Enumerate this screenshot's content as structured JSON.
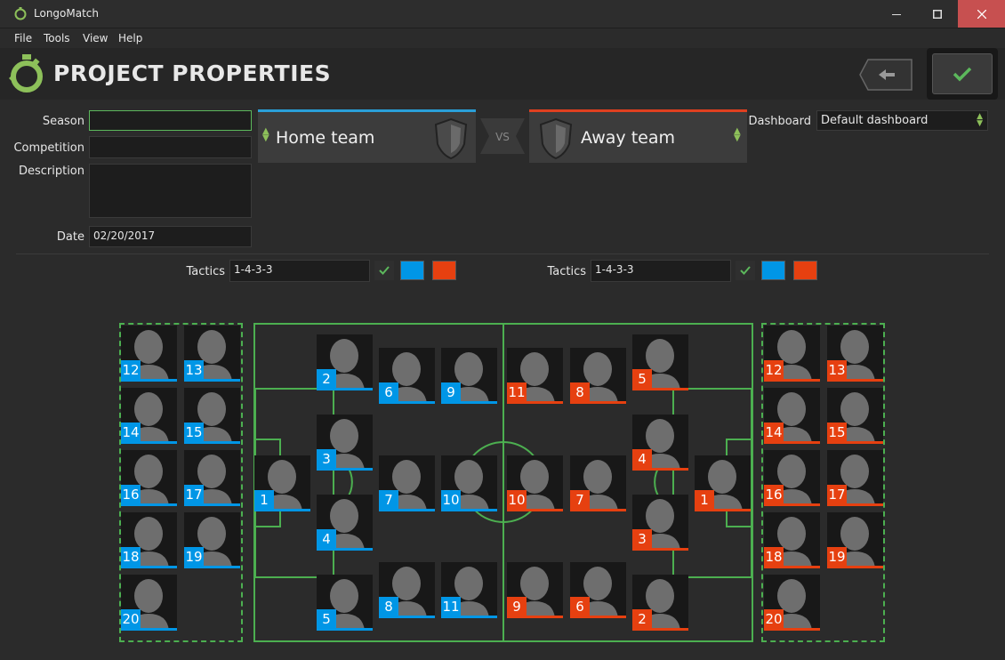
{
  "window": {
    "title": "LongoMatch"
  },
  "menu": [
    {
      "label": "File",
      "key": "F"
    },
    {
      "label": "Tools",
      "key": "T"
    },
    {
      "label": "View",
      "key": "V"
    },
    {
      "label": "Help",
      "key": "H"
    }
  ],
  "header": {
    "title": "PROJECT PROPERTIES"
  },
  "form": {
    "season_label": "Season",
    "season_value": "",
    "competition_label": "Competition",
    "competition_value": "",
    "description_label": "Description",
    "description_value": "",
    "date_label": "Date",
    "date_value": "02/20/2017"
  },
  "teams": {
    "home": "Home team",
    "away": "Away team",
    "vs": "VS"
  },
  "dashboard": {
    "label": "Dashboard",
    "value": "Default dashboard"
  },
  "tactics": {
    "label": "Tactics",
    "home_value": "1-4-3-3",
    "away_value": "1-4-3-3",
    "home_color": "#0096e6",
    "away_color": "#e64010"
  },
  "home_bench": [
    "12",
    "13",
    "14",
    "15",
    "16",
    "17",
    "18",
    "19",
    "20"
  ],
  "away_bench": [
    "12",
    "13",
    "14",
    "15",
    "16",
    "17",
    "18",
    "19",
    "20"
  ],
  "home_field": [
    "1",
    "2",
    "3",
    "4",
    "5",
    "6",
    "7",
    "8",
    "9",
    "10",
    "11"
  ],
  "away_field": [
    "1",
    "2",
    "3",
    "4",
    "5",
    "6",
    "7",
    "8",
    "9",
    "10",
    "11"
  ],
  "colors": {
    "accent": "#4caf50",
    "home": "#0096e6",
    "away": "#e64010"
  }
}
